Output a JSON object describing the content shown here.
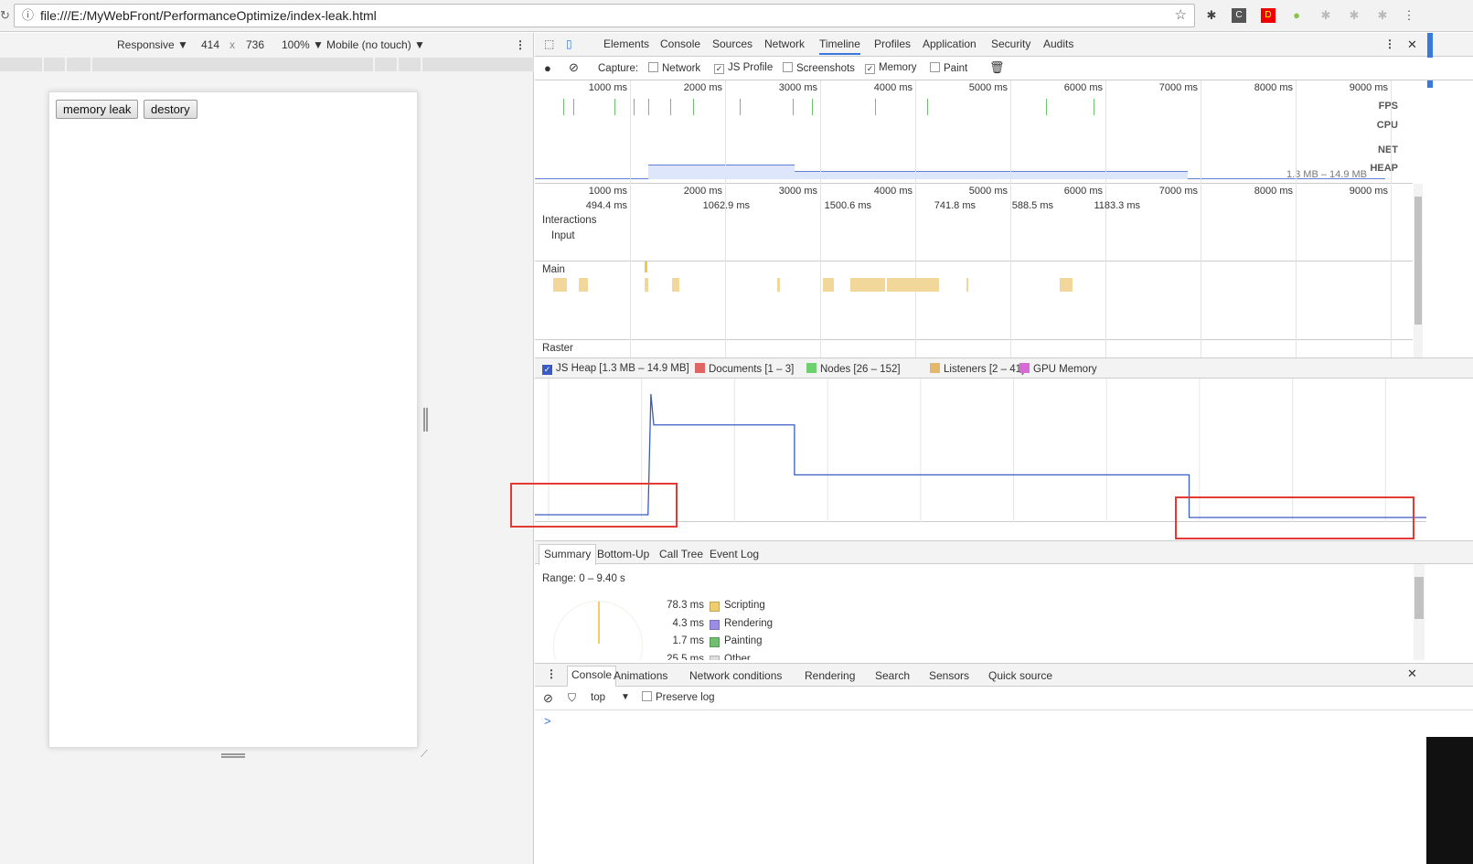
{
  "browser": {
    "url": "file:///E:/MyWebFront/PerformanceOptimize/index-leak.html",
    "extensions": [
      "puzzle-icon",
      "C",
      "D",
      "android-icon",
      "puzzle-icon",
      "puzzle-icon",
      "puzzle-icon"
    ]
  },
  "device_toolbar": {
    "mode": "Responsive ▼",
    "width": "414",
    "x": "x",
    "height": "736",
    "zoom": "100% ▼",
    "touch": "Mobile (no touch) ▼"
  },
  "page": {
    "buttons": [
      "memory leak",
      "destory"
    ]
  },
  "devtools": {
    "tabs": [
      "Elements",
      "Console",
      "Sources",
      "Network",
      "Timeline",
      "Profiles",
      "Application",
      "Security",
      "Audits"
    ],
    "active_tab": "Timeline",
    "capture": {
      "label": "Capture:",
      "options": [
        {
          "label": "Network",
          "checked": false
        },
        {
          "label": "JS Profile",
          "checked": true
        },
        {
          "label": "Screenshots",
          "checked": false
        },
        {
          "label": "Memory",
          "checked": true
        },
        {
          "label": "Paint",
          "checked": false
        }
      ]
    },
    "overview": {
      "ticks": [
        "1000 ms",
        "2000 ms",
        "3000 ms",
        "4000 ms",
        "5000 ms",
        "6000 ms",
        "7000 ms",
        "8000 ms",
        "9000 ms"
      ],
      "rows": [
        "FPS",
        "CPU",
        "NET",
        "HEAP"
      ],
      "heap_range": "1.3 MB – 14.9 MB"
    },
    "frames": [
      "494.4 ms",
      "1062.9 ms",
      "1500.6 ms",
      "741.8 ms",
      "588.5 ms",
      "1183.3 ms"
    ],
    "tracks": {
      "interactions": "Interactions",
      "input": "Input",
      "main": "Main",
      "raster": "Raster"
    },
    "counters": [
      {
        "label": "JS Heap [1.3 MB – 14.9 MB]",
        "color": "#3b5bc4",
        "checked": true
      },
      {
        "label": "Documents [1 – 3]",
        "color": "#e06666",
        "checked": false
      },
      {
        "label": "Nodes [26 – 152]",
        "color": "#6fd06f",
        "checked": false
      },
      {
        "label": "Listeners [2 – 41]",
        "color": "#e3b86b",
        "checked": false
      },
      {
        "label": "GPU Memory",
        "color": "#d86ad8",
        "checked": false
      }
    ],
    "summary": {
      "tabs": [
        "Summary",
        "Bottom-Up",
        "Call Tree",
        "Event Log"
      ],
      "range": "Range: 0 – 9.40 s",
      "items": [
        {
          "time": "78.3 ms",
          "label": "Scripting",
          "color": "#f0cd6d"
        },
        {
          "time": "4.3 ms",
          "label": "Rendering",
          "color": "#9b8de5"
        },
        {
          "time": "1.7 ms",
          "label": "Painting",
          "color": "#6fbf6f"
        },
        {
          "time": "25.5 ms",
          "label": "Other",
          "color": "#dddddd"
        }
      ]
    },
    "drawer": {
      "tabs": [
        "Console",
        "Animations",
        "Network conditions",
        "Rendering",
        "Search",
        "Sensors",
        "Quick source"
      ],
      "context": "top",
      "preserve_log": "Preserve log",
      "prompt": ">"
    }
  },
  "chart_data": {
    "type": "line",
    "series": [
      {
        "name": "JS Heap",
        "x_s": [
          0,
          1.19,
          1.22,
          1.25,
          2.73,
          2.73,
          6.88,
          6.88,
          9.4
        ],
        "y_mb": [
          1.6,
          1.6,
          14.9,
          11.5,
          11.5,
          6.0,
          6.0,
          1.3,
          1.3
        ]
      }
    ],
    "xlim": [
      0,
      9.4
    ],
    "ylim": [
      1.3,
      14.9
    ],
    "color": "#3b5bc4"
  }
}
